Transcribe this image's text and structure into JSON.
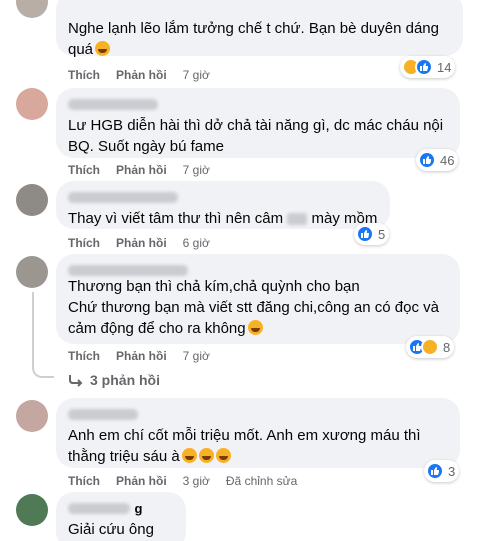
{
  "actions": {
    "like": "Thích",
    "reply": "Phản hồi"
  },
  "comments": [
    {
      "text": "Nghe lạnh lẽo lắm tưởng chế t chứ. Bạn bè duyên dáng\nquá",
      "time": "7 giờ",
      "reaction_count": "14",
      "reactions": [
        "haha-icon",
        "like-icon"
      ]
    },
    {
      "text": "Lư HGB diễn hài thì dở chả tài năng gì, dc mác cháu nội\nBQ. Suốt ngày bú fame",
      "time": "7 giờ",
      "reaction_count": "46",
      "reactions": [
        "like-icon"
      ]
    },
    {
      "text_a": "Thay vì viết tâm thư thì nên câm",
      "text_b": "mày mồm",
      "time": "6 giờ",
      "reaction_count": "5",
      "reactions": [
        "like-icon"
      ]
    },
    {
      "text": "Thương bạn thì chả kím,chả quỳnh cho bạn\nChứ thương bạn mà viết stt đăng chi,công an có đọc và\ncảm động để cho ra không",
      "time": "7 giờ",
      "reaction_count": "8",
      "reactions": [
        "like-icon",
        "haha-icon"
      ],
      "replies": "3 phản hồi"
    },
    {
      "text": "Anh em chí cốt mỗi triệu mốt. Anh em xương máu thì\nthằng triệu sáu à",
      "time": "3 giờ",
      "edited": "Đã chỉnh sửa",
      "reaction_count": "3",
      "reactions": [
        "like-icon"
      ]
    },
    {
      "author_partial": "g",
      "text": "Giải cứu ông sói"
    }
  ],
  "colors": {
    "bubble": "#f0f2f5",
    "muted": "#65676b",
    "like": "#1877f2",
    "haha": "#f7b125"
  }
}
